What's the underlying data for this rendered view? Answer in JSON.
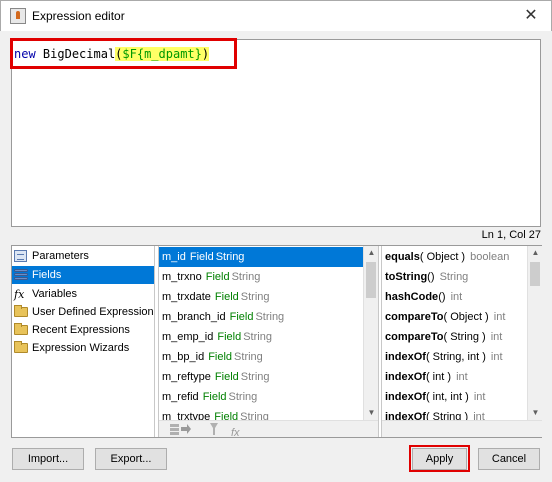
{
  "window": {
    "title": "Expression editor",
    "close_glyph": "✕"
  },
  "editor": {
    "tokens": {
      "keyword": "new",
      "class_name": "BigDecimal",
      "open_paren": "(",
      "field_ref": "$F{m_dpamt}",
      "close_paren": ")"
    }
  },
  "status": {
    "cursor": "Ln 1, Col 27"
  },
  "categories": [
    {
      "label": "Parameters",
      "icon": "parameters-icon"
    },
    {
      "label": "Fields",
      "icon": "fields-icon",
      "selected": true
    },
    {
      "label": "Variables",
      "icon": "fx-icon"
    },
    {
      "label": "User Defined Expressions",
      "icon": "folder-icon"
    },
    {
      "label": "Recent Expressions",
      "icon": "folder-icon"
    },
    {
      "label": "Expression Wizards",
      "icon": "folder-icon"
    }
  ],
  "fields": [
    {
      "name": "m_id",
      "kind": "Field",
      "type": "String",
      "selected": true
    },
    {
      "name": "m_trxno",
      "kind": "Field",
      "type": "String"
    },
    {
      "name": "m_trxdate",
      "kind": "Field",
      "type": "String"
    },
    {
      "name": "m_branch_id",
      "kind": "Field",
      "type": "String"
    },
    {
      "name": "m_emp_id",
      "kind": "Field",
      "type": "String"
    },
    {
      "name": "m_bp_id",
      "kind": "Field",
      "type": "String"
    },
    {
      "name": "m_reftype",
      "kind": "Field",
      "type": "String"
    },
    {
      "name": "m_refid",
      "kind": "Field",
      "type": "String"
    },
    {
      "name": "m_trxtype",
      "kind": "Field",
      "type": "String"
    }
  ],
  "methods": [
    {
      "name": "equals",
      "args": "( Object )",
      "ret": "boolean"
    },
    {
      "name": "toString",
      "args": "()",
      "ret": "String"
    },
    {
      "name": "hashCode",
      "args": "()",
      "ret": "int"
    },
    {
      "name": "compareTo",
      "args": "( Object )",
      "ret": "int"
    },
    {
      "name": "compareTo",
      "args": "( String )",
      "ret": "int"
    },
    {
      "name": "indexOf",
      "args": "( String, int )",
      "ret": "int"
    },
    {
      "name": "indexOf",
      "args": "( int )",
      "ret": "int"
    },
    {
      "name": "indexOf",
      "args": "( int, int )",
      "ret": "int"
    },
    {
      "name": "indexOf",
      "args": "( String )",
      "ret": "int"
    }
  ],
  "toolbar": {
    "fields_tool_icon": "insert-field-icon",
    "fx_tool_icon": "filter-fx-icon",
    "fx_tool_glyph": "fx"
  },
  "buttons": {
    "import": "Import...",
    "export": "Export...",
    "apply": "Apply",
    "cancel": "Cancel"
  },
  "colors": {
    "selection": "#0078d7",
    "highlight_box": "#e00000",
    "field_kind": "#008000",
    "keyword": "#0000aa"
  }
}
